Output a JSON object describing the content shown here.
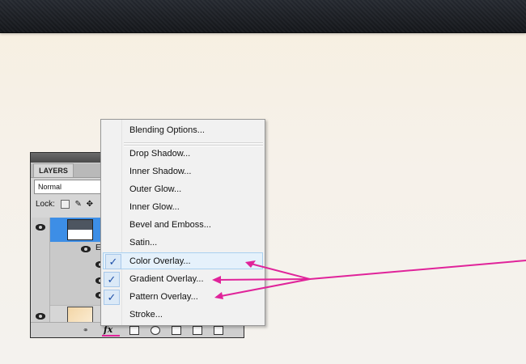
{
  "panel": {
    "tab_label": "LAYERS",
    "blend_mode": "Normal",
    "lock_label": "Lock:",
    "effects_label": "Eff"
  },
  "menu": {
    "items": [
      {
        "label": "Blending Options...",
        "checked": false
      },
      {
        "label": "Drop Shadow...",
        "checked": false
      },
      {
        "label": "Inner Shadow...",
        "checked": false
      },
      {
        "label": "Outer Glow...",
        "checked": false
      },
      {
        "label": "Inner Glow...",
        "checked": false
      },
      {
        "label": "Bevel and Emboss...",
        "checked": false
      },
      {
        "label": "Satin...",
        "checked": false
      },
      {
        "label": "Color Overlay...",
        "checked": true,
        "highlighted": true
      },
      {
        "label": "Gradient Overlay...",
        "checked": true
      },
      {
        "label": "Pattern Overlay...",
        "checked": true
      },
      {
        "label": "Stroke...",
        "checked": false
      }
    ],
    "check_glyph": "✓"
  },
  "fx_button_label": "fx",
  "colors": {
    "annotation": "#e0239a",
    "selection": "#3d8ee6",
    "check": "#1e4fa8"
  }
}
